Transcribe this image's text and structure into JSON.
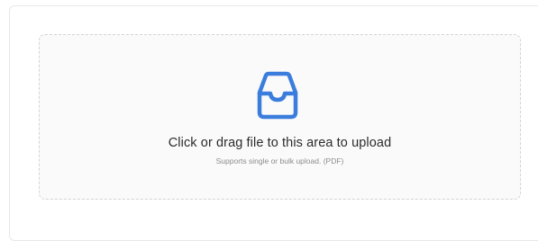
{
  "upload": {
    "icon": "inbox-icon",
    "accent_color": "#3b7ddd",
    "hint": "Click or drag file to this area to upload",
    "subhint": "Supports single or bulk upload. (PDF)"
  }
}
